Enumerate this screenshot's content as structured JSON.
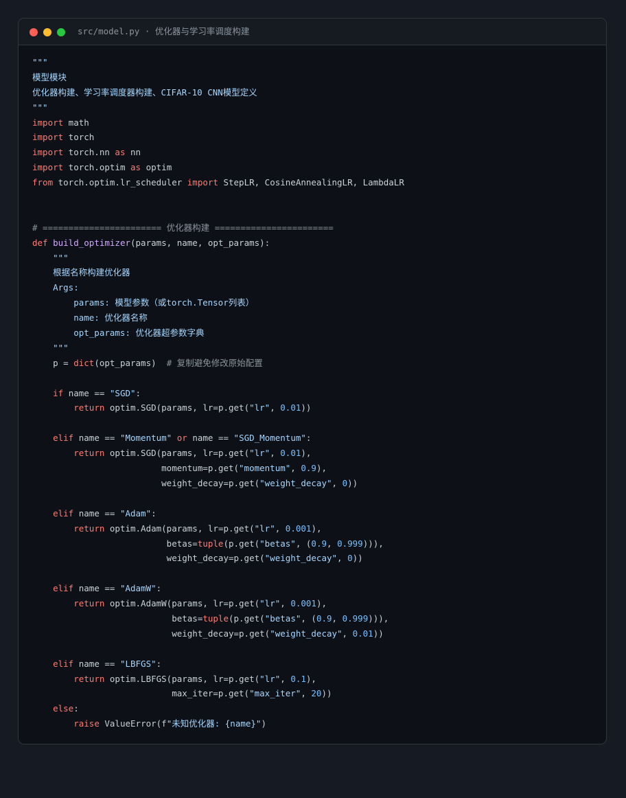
{
  "window": {
    "title": "src/model.py · 优化器与学习率调度构建",
    "controls": {
      "close": "#ff5f56",
      "minimize": "#ffbd2e",
      "maximize": "#27c93f"
    }
  },
  "colors": {
    "background": "#151a23",
    "editor": "#0d1117",
    "plain": "#c9d1d9",
    "keyword": "#ff7b72",
    "string": "#a5d6ff",
    "number": "#79c0ff",
    "function": "#d2a8ff",
    "comment": "#8b949e"
  },
  "code_lines": [
    [
      {
        "t": "\"\"\"",
        "c": "string"
      }
    ],
    [
      {
        "t": "模型模块",
        "c": "string"
      }
    ],
    [
      {
        "t": "优化器构建、学习率调度器构建、CIFAR-10 CNN模型定义",
        "c": "string"
      }
    ],
    [
      {
        "t": "\"\"\"",
        "c": "string"
      }
    ],
    [
      {
        "t": "import",
        "c": "keyword"
      },
      {
        "t": " math",
        "c": "plain"
      }
    ],
    [
      {
        "t": "import",
        "c": "keyword"
      },
      {
        "t": " torch",
        "c": "plain"
      }
    ],
    [
      {
        "t": "import",
        "c": "keyword"
      },
      {
        "t": " torch.nn ",
        "c": "plain"
      },
      {
        "t": "as",
        "c": "keyword"
      },
      {
        "t": " nn",
        "c": "plain"
      }
    ],
    [
      {
        "t": "import",
        "c": "keyword"
      },
      {
        "t": " torch.optim ",
        "c": "plain"
      },
      {
        "t": "as",
        "c": "keyword"
      },
      {
        "t": " optim",
        "c": "plain"
      }
    ],
    [
      {
        "t": "from",
        "c": "keyword"
      },
      {
        "t": " torch.optim.lr_scheduler ",
        "c": "plain"
      },
      {
        "t": "import",
        "c": "keyword"
      },
      {
        "t": " StepLR, CosineAnnealingLR, LambdaLR",
        "c": "plain"
      }
    ],
    [],
    [],
    [
      {
        "t": "# ======================= 优化器构建 =======================",
        "c": "comment"
      }
    ],
    [
      {
        "t": "def",
        "c": "keyword"
      },
      {
        "t": " ",
        "c": "plain"
      },
      {
        "t": "build_optimizer",
        "c": "function"
      },
      {
        "t": "(params, name, opt_params):",
        "c": "plain"
      }
    ],
    [
      {
        "t": "    \"\"\"",
        "c": "string"
      }
    ],
    [
      {
        "t": "    根据名称构建优化器",
        "c": "string"
      }
    ],
    [
      {
        "t": "    Args:",
        "c": "string"
      }
    ],
    [
      {
        "t": "        params: 模型参数（或torch.Tensor列表）",
        "c": "string"
      }
    ],
    [
      {
        "t": "        name: 优化器名称",
        "c": "string"
      }
    ],
    [
      {
        "t": "        opt_params: 优化器超参数字典",
        "c": "string"
      }
    ],
    [
      {
        "t": "    \"\"\"",
        "c": "string"
      }
    ],
    [
      {
        "t": "    p = ",
        "c": "plain"
      },
      {
        "t": "dict",
        "c": "keyword"
      },
      {
        "t": "(opt_params)  ",
        "c": "plain"
      },
      {
        "t": "# 复制避免修改原始配置",
        "c": "comment"
      }
    ],
    [],
    [
      {
        "t": "    ",
        "c": "plain"
      },
      {
        "t": "if",
        "c": "keyword"
      },
      {
        "t": " name == ",
        "c": "plain"
      },
      {
        "t": "\"SGD\"",
        "c": "string"
      },
      {
        "t": ":",
        "c": "plain"
      }
    ],
    [
      {
        "t": "        ",
        "c": "plain"
      },
      {
        "t": "return",
        "c": "keyword"
      },
      {
        "t": " optim.SGD(params, lr=p.get(",
        "c": "plain"
      },
      {
        "t": "\"lr\"",
        "c": "string"
      },
      {
        "t": ", ",
        "c": "plain"
      },
      {
        "t": "0.01",
        "c": "number"
      },
      {
        "t": "))",
        "c": "plain"
      }
    ],
    [],
    [
      {
        "t": "    ",
        "c": "plain"
      },
      {
        "t": "elif",
        "c": "keyword"
      },
      {
        "t": " name == ",
        "c": "plain"
      },
      {
        "t": "\"Momentum\"",
        "c": "string"
      },
      {
        "t": " ",
        "c": "plain"
      },
      {
        "t": "or",
        "c": "keyword"
      },
      {
        "t": " name == ",
        "c": "plain"
      },
      {
        "t": "\"SGD_Momentum\"",
        "c": "string"
      },
      {
        "t": ":",
        "c": "plain"
      }
    ],
    [
      {
        "t": "        ",
        "c": "plain"
      },
      {
        "t": "return",
        "c": "keyword"
      },
      {
        "t": " optim.SGD(params, lr=p.get(",
        "c": "plain"
      },
      {
        "t": "\"lr\"",
        "c": "string"
      },
      {
        "t": ", ",
        "c": "plain"
      },
      {
        "t": "0.01",
        "c": "number"
      },
      {
        "t": "),",
        "c": "plain"
      }
    ],
    [
      {
        "t": "                         momentum=p.get(",
        "c": "plain"
      },
      {
        "t": "\"momentum\"",
        "c": "string"
      },
      {
        "t": ", ",
        "c": "plain"
      },
      {
        "t": "0.9",
        "c": "number"
      },
      {
        "t": "),",
        "c": "plain"
      }
    ],
    [
      {
        "t": "                         weight_decay=p.get(",
        "c": "plain"
      },
      {
        "t": "\"weight_decay\"",
        "c": "string"
      },
      {
        "t": ", ",
        "c": "plain"
      },
      {
        "t": "0",
        "c": "number"
      },
      {
        "t": "))",
        "c": "plain"
      }
    ],
    [],
    [
      {
        "t": "    ",
        "c": "plain"
      },
      {
        "t": "elif",
        "c": "keyword"
      },
      {
        "t": " name == ",
        "c": "plain"
      },
      {
        "t": "\"Adam\"",
        "c": "string"
      },
      {
        "t": ":",
        "c": "plain"
      }
    ],
    [
      {
        "t": "        ",
        "c": "plain"
      },
      {
        "t": "return",
        "c": "keyword"
      },
      {
        "t": " optim.Adam(params, lr=p.get(",
        "c": "plain"
      },
      {
        "t": "\"lr\"",
        "c": "string"
      },
      {
        "t": ", ",
        "c": "plain"
      },
      {
        "t": "0.001",
        "c": "number"
      },
      {
        "t": "),",
        "c": "plain"
      }
    ],
    [
      {
        "t": "                          betas=",
        "c": "plain"
      },
      {
        "t": "tuple",
        "c": "keyword"
      },
      {
        "t": "(p.get(",
        "c": "plain"
      },
      {
        "t": "\"betas\"",
        "c": "string"
      },
      {
        "t": ", (",
        "c": "plain"
      },
      {
        "t": "0.9",
        "c": "number"
      },
      {
        "t": ", ",
        "c": "plain"
      },
      {
        "t": "0.999",
        "c": "number"
      },
      {
        "t": "))),",
        "c": "plain"
      }
    ],
    [
      {
        "t": "                          weight_decay=p.get(",
        "c": "plain"
      },
      {
        "t": "\"weight_decay\"",
        "c": "string"
      },
      {
        "t": ", ",
        "c": "plain"
      },
      {
        "t": "0",
        "c": "number"
      },
      {
        "t": "))",
        "c": "plain"
      }
    ],
    [],
    [
      {
        "t": "    ",
        "c": "plain"
      },
      {
        "t": "elif",
        "c": "keyword"
      },
      {
        "t": " name == ",
        "c": "plain"
      },
      {
        "t": "\"AdamW\"",
        "c": "string"
      },
      {
        "t": ":",
        "c": "plain"
      }
    ],
    [
      {
        "t": "        ",
        "c": "plain"
      },
      {
        "t": "return",
        "c": "keyword"
      },
      {
        "t": " optim.AdamW(params, lr=p.get(",
        "c": "plain"
      },
      {
        "t": "\"lr\"",
        "c": "string"
      },
      {
        "t": ", ",
        "c": "plain"
      },
      {
        "t": "0.001",
        "c": "number"
      },
      {
        "t": "),",
        "c": "plain"
      }
    ],
    [
      {
        "t": "                           betas=",
        "c": "plain"
      },
      {
        "t": "tuple",
        "c": "keyword"
      },
      {
        "t": "(p.get(",
        "c": "plain"
      },
      {
        "t": "\"betas\"",
        "c": "string"
      },
      {
        "t": ", (",
        "c": "plain"
      },
      {
        "t": "0.9",
        "c": "number"
      },
      {
        "t": ", ",
        "c": "plain"
      },
      {
        "t": "0.999",
        "c": "number"
      },
      {
        "t": "))),",
        "c": "plain"
      }
    ],
    [
      {
        "t": "                           weight_decay=p.get(",
        "c": "plain"
      },
      {
        "t": "\"weight_decay\"",
        "c": "string"
      },
      {
        "t": ", ",
        "c": "plain"
      },
      {
        "t": "0.01",
        "c": "number"
      },
      {
        "t": "))",
        "c": "plain"
      }
    ],
    [],
    [
      {
        "t": "    ",
        "c": "plain"
      },
      {
        "t": "elif",
        "c": "keyword"
      },
      {
        "t": " name == ",
        "c": "plain"
      },
      {
        "t": "\"LBFGS\"",
        "c": "string"
      },
      {
        "t": ":",
        "c": "plain"
      }
    ],
    [
      {
        "t": "        ",
        "c": "plain"
      },
      {
        "t": "return",
        "c": "keyword"
      },
      {
        "t": " optim.LBFGS(params, lr=p.get(",
        "c": "plain"
      },
      {
        "t": "\"lr\"",
        "c": "string"
      },
      {
        "t": ", ",
        "c": "plain"
      },
      {
        "t": "0.1",
        "c": "number"
      },
      {
        "t": "),",
        "c": "plain"
      }
    ],
    [
      {
        "t": "                           max_iter=p.get(",
        "c": "plain"
      },
      {
        "t": "\"max_iter\"",
        "c": "string"
      },
      {
        "t": ", ",
        "c": "plain"
      },
      {
        "t": "20",
        "c": "number"
      },
      {
        "t": "))",
        "c": "plain"
      }
    ],
    [
      {
        "t": "    ",
        "c": "plain"
      },
      {
        "t": "else",
        "c": "keyword"
      },
      {
        "t": ":",
        "c": "plain"
      }
    ],
    [
      {
        "t": "        ",
        "c": "plain"
      },
      {
        "t": "raise",
        "c": "keyword"
      },
      {
        "t": " ValueError(f",
        "c": "plain"
      },
      {
        "t": "\"未知优化器: {name}\"",
        "c": "string"
      },
      {
        "t": ")",
        "c": "plain"
      }
    ]
  ]
}
